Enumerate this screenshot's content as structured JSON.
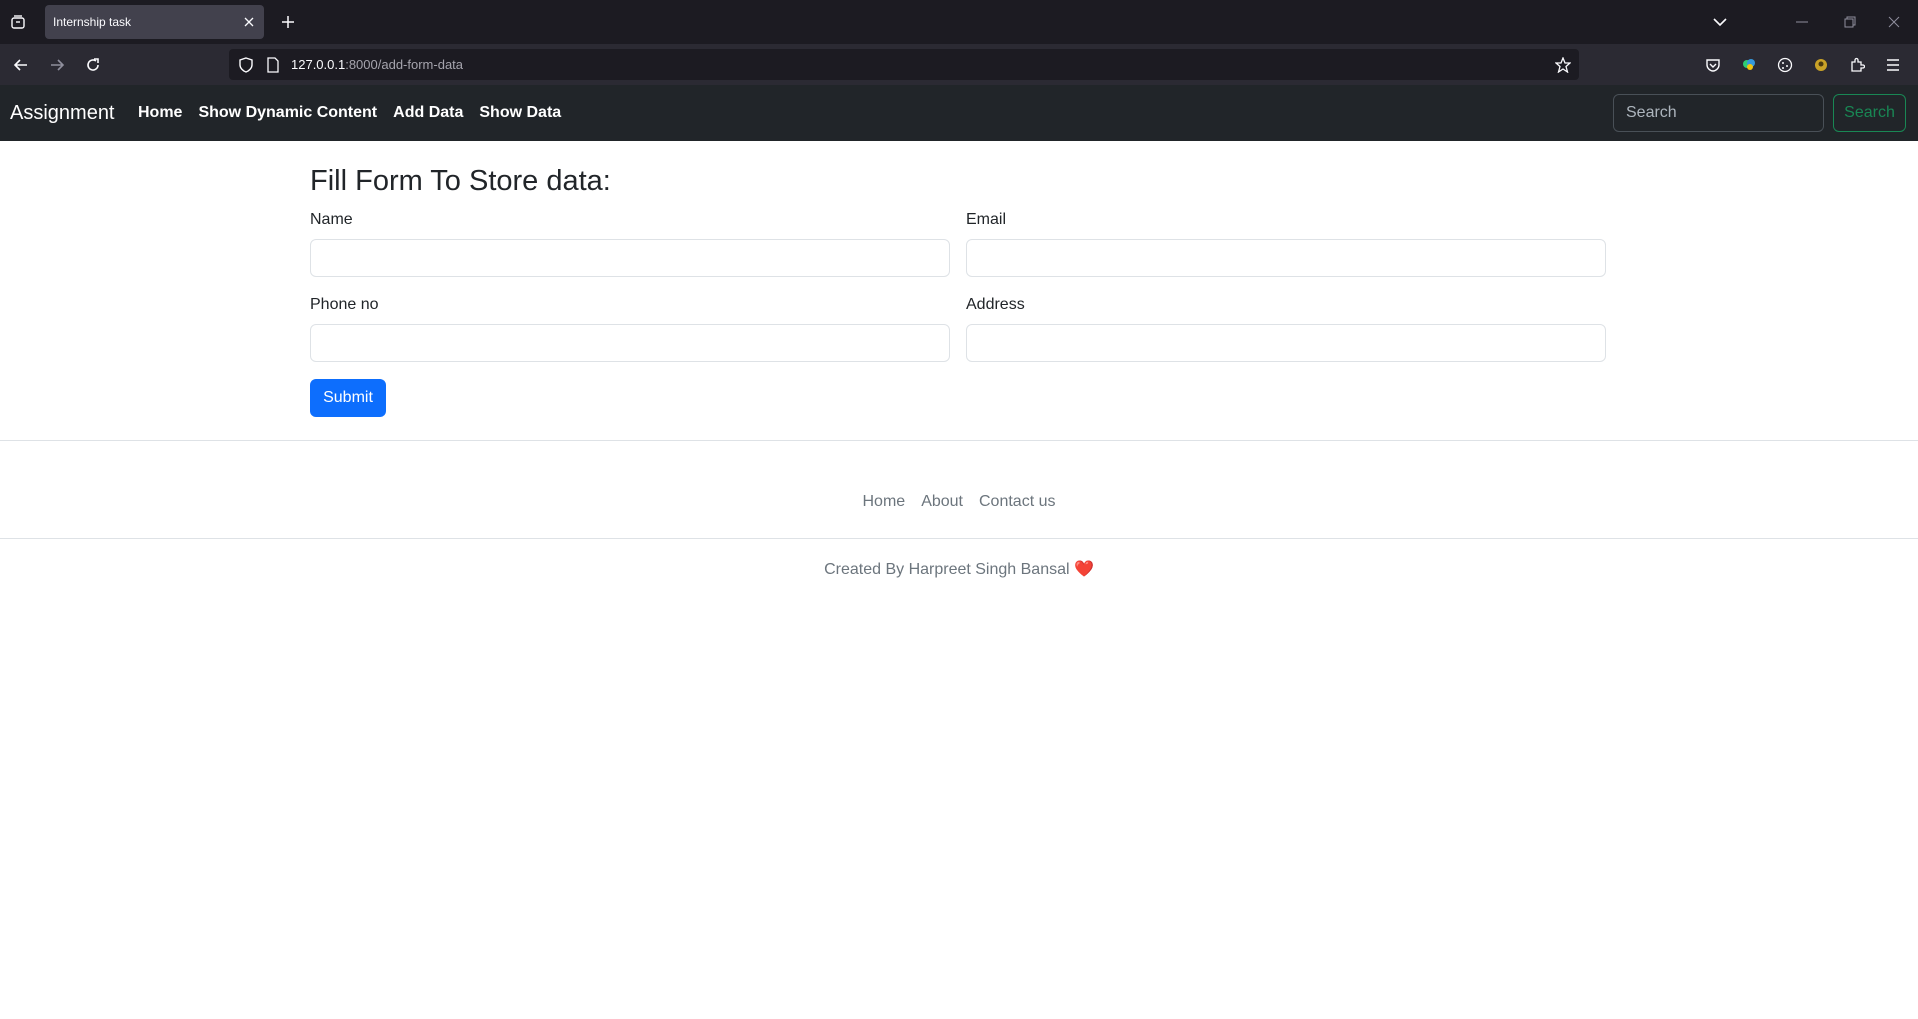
{
  "browser": {
    "tab_title": "Internship task",
    "url_host": "127.0.0.1",
    "url_rest": ":8000/add-form-data"
  },
  "site": {
    "brand": "Assignment",
    "nav": [
      "Home",
      "Show Dynamic Content",
      "Add Data",
      "Show Data"
    ],
    "search_placeholder": "Search",
    "search_button": "Search"
  },
  "form": {
    "title": "Fill Form To Store data:",
    "name_label": "Name",
    "email_label": "Email",
    "phone_label": "Phone no",
    "address_label": "Address",
    "name_value": "",
    "email_value": "",
    "phone_value": "",
    "address_value": "",
    "submit_label": "Submit"
  },
  "footer": {
    "links": [
      "Home",
      "About",
      "Contact us"
    ],
    "credit": "Created By Harpreet Singh Bansal",
    "heart": "❤️"
  },
  "colors": {
    "navbar_bg": "#212529",
    "submit_bg": "#0d6efd",
    "search_button": "#198754"
  }
}
